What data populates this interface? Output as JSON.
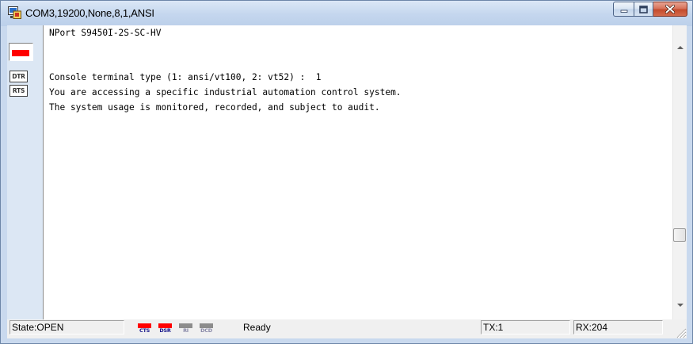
{
  "window": {
    "title": "COM3,19200,None,8,1,ANSI"
  },
  "left_panel": {
    "dtr_label": "DTR",
    "rts_label": "RTS"
  },
  "terminal": {
    "lines": [
      "NPort S9450I-2S-SC-HV",
      "",
      "Console terminal type (1: ansi/vt100, 2: vt52) :  1",
      "You are accessing a specific industrial automation control system.",
      "The system usage is monitored, recorded, and subject to audit."
    ]
  },
  "statusbar": {
    "state": "State:OPEN",
    "indicators": [
      {
        "label": "CTS",
        "color": "#ff0000"
      },
      {
        "label": "DSR",
        "color": "#ff0000"
      },
      {
        "label": "RI",
        "color": "#8c8c8c"
      },
      {
        "label": "DCD",
        "color": "#8c8c8c"
      }
    ],
    "ready": "Ready",
    "tx": "TX:1",
    "rx": "RX:204"
  },
  "colors": {
    "led_active": "#ff0000",
    "led_inactive": "#8c8c8c",
    "close_button": "#c44a2c"
  }
}
